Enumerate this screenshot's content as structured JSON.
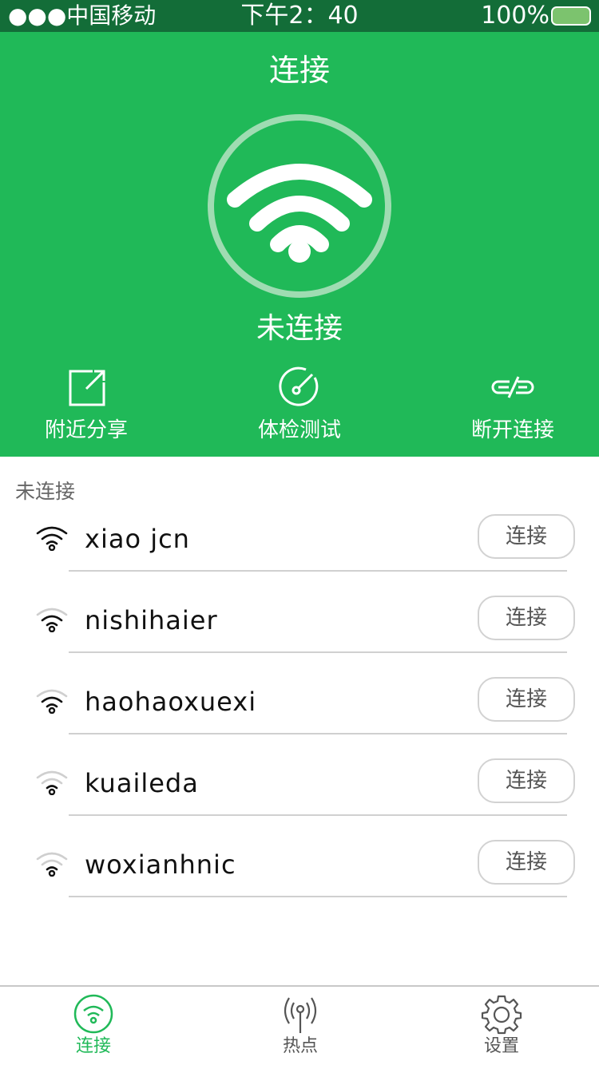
{
  "status_bar": {
    "carrier": "●●●中国移动",
    "time": "下午2：40",
    "battery_percent": "100%",
    "battery_level": 1.0
  },
  "header": {
    "title": "连接",
    "connection_status": "未连接",
    "main_icon": "wifi-icon"
  },
  "actions": [
    {
      "label": "附近分享",
      "icon": "share-icon"
    },
    {
      "label": "体检测试",
      "icon": "speed-test-icon"
    },
    {
      "label": "断开连接",
      "icon": "unlink-icon"
    }
  ],
  "network_section": {
    "label": "未连接",
    "networks": [
      {
        "ssid": "xiao jcn",
        "signal_bars": 3,
        "button": "连接"
      },
      {
        "ssid": "nishihaier",
        "signal_bars": 2,
        "button": "连接"
      },
      {
        "ssid": "haohaoxuexi",
        "signal_bars": 2,
        "button": "连接"
      },
      {
        "ssid": "kuaileda",
        "signal_bars": 1,
        "button": "连接"
      },
      {
        "ssid": "woxianhnic",
        "signal_bars": 1,
        "button": "连接"
      }
    ]
  },
  "tabbar": {
    "tabs": [
      {
        "label": "连接",
        "icon": "wifi-circle-icon",
        "active": true
      },
      {
        "label": "热点",
        "icon": "hotspot-icon",
        "active": false
      },
      {
        "label": "设置",
        "icon": "gear-icon",
        "active": false
      }
    ]
  },
  "colors": {
    "brand_green": "#20b958",
    "status_bar_green": "#136d38",
    "ring": "#9fdcb2",
    "battery_fill": "#7cc36e"
  }
}
